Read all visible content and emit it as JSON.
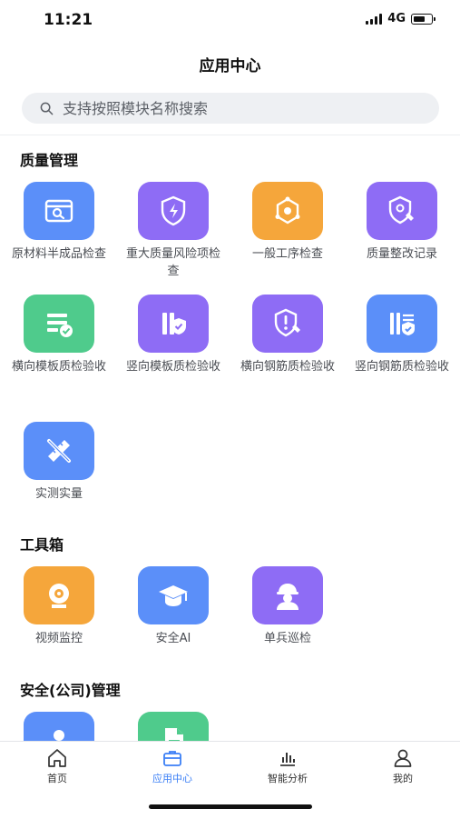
{
  "status_bar": {
    "time": "11:21",
    "network": "4G",
    "battery_level": 0.75
  },
  "header": {
    "title": "应用中心"
  },
  "search": {
    "placeholder": "支持按照模块名称搜索"
  },
  "colors": {
    "accent": "#3b7ff6",
    "blue_tile": "#5b8ff9",
    "purple_tile": "#8e6cf5",
    "orange_tile": "#f5a63b",
    "green_tile": "#4fcb8c"
  },
  "sections": [
    {
      "title": "质量管理",
      "apps": [
        {
          "label": "原材料半成品检查",
          "icon": "material-box-search-icon",
          "color": "#5b8ff9"
        },
        {
          "label": "重大质量风险项检查",
          "icon": "shield-lightning-icon",
          "color": "#8e6cf5"
        },
        {
          "label": "一般工序检查",
          "icon": "process-hexagon-icon",
          "color": "#f5a63b"
        },
        {
          "label": "质量整改记录",
          "icon": "shield-edit-icon",
          "color": "#8e6cf5"
        },
        {
          "label": "横向模板质检验收",
          "icon": "list-check-icon",
          "color": "#4fcb8c"
        },
        {
          "label": "竖向模板质检验收",
          "icon": "bars-check-icon",
          "color": "#8e6cf5"
        },
        {
          "label": "横向钢筋质检验收",
          "icon": "shield-alert-edit-icon",
          "color": "#8e6cf5"
        },
        {
          "label": "竖向钢筋质检验收",
          "icon": "rebar-check-icon",
          "color": "#5b8ff9"
        },
        {
          "label": "实测实量",
          "icon": "ruler-pencil-icon",
          "color": "#5b8ff9"
        }
      ]
    },
    {
      "title": "工具箱",
      "apps": [
        {
          "label": "视频监控",
          "icon": "camera-icon",
          "color": "#f5a63b"
        },
        {
          "label": "安全AI",
          "icon": "graduation-cap-icon",
          "color": "#5b8ff9"
        },
        {
          "label": "单兵巡检",
          "icon": "worker-helmet-icon",
          "color": "#8e6cf5"
        }
      ]
    },
    {
      "title": "安全(公司)管理",
      "apps": [
        {
          "label": "",
          "icon": "person-icon",
          "color": "#5b8ff9"
        },
        {
          "label": "",
          "icon": "document-icon",
          "color": "#4fcb8c"
        }
      ]
    }
  ],
  "tabbar": [
    {
      "label": "首页",
      "icon": "home-icon",
      "active": false
    },
    {
      "label": "应用中心",
      "icon": "briefcase-icon",
      "active": true
    },
    {
      "label": "智能分析",
      "icon": "bar-chart-icon",
      "active": false
    },
    {
      "label": "我的",
      "icon": "user-icon",
      "active": false
    }
  ]
}
